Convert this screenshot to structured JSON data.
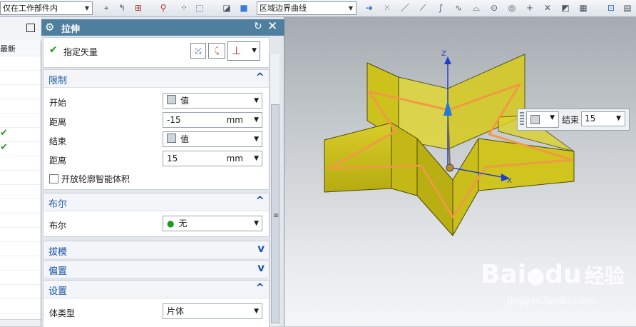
{
  "toolbar": {
    "filter_combo": "仅在工作部件内",
    "curve_rule_combo": "区域边界曲线"
  },
  "dialog": {
    "title": "拉伸",
    "vector": {
      "label": "指定矢量"
    },
    "limits": {
      "header": "限制",
      "start_label": "开始",
      "start_value": "值",
      "start_distance_label": "距离",
      "start_distance": "-15",
      "unit": "mm",
      "end_label": "结束",
      "end_value": "值",
      "end_distance_label": "距离",
      "end_distance": "15",
      "open_profile_label": "开放轮廓智能体积"
    },
    "boolean": {
      "header": "布尔",
      "label": "布尔",
      "value": "无"
    },
    "draft": {
      "header": "拔模"
    },
    "offset": {
      "header": "偏置"
    },
    "settings": {
      "header": "设置",
      "body_type_label": "体类型",
      "body_type_value": "片体"
    }
  },
  "navigator": {
    "latest_label": "最新"
  },
  "viewport": {
    "axis_x": "X",
    "axis_z": "Z",
    "floating": {
      "label": "结束",
      "value": "15"
    }
  },
  "watermark": {
    "brand_a": "Bai",
    "brand_b": "du",
    "brand_c": "经验",
    "url": "jingyan.baidu.com"
  },
  "colors": {
    "star_fill": "#c8bd16",
    "profile": "#ef9a45",
    "title_bar": "#4f7f9e",
    "section_text": "#1c57a6"
  }
}
